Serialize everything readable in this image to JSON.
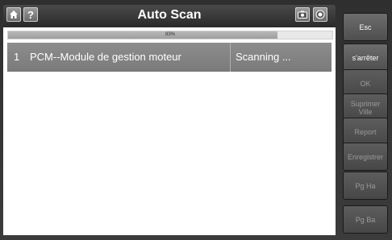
{
  "title": "Auto Scan",
  "progress": {
    "percent": 83,
    "label": "83%"
  },
  "rows": [
    {
      "index": "1",
      "name": "PCM--Module de gestion moteur",
      "status": "Scanning ..."
    }
  ],
  "buttons": {
    "esc": "Esc",
    "stop": "s'arrêter",
    "ok": "OK",
    "delete": "Suprimer Ville",
    "report": "Report",
    "save": "Enregistrer",
    "page_up": "Pg Ha",
    "page_down": "Pg Ba"
  },
  "icons": {
    "home": "home-icon",
    "help": "help-icon",
    "camera": "camera-icon",
    "record": "record-icon"
  }
}
